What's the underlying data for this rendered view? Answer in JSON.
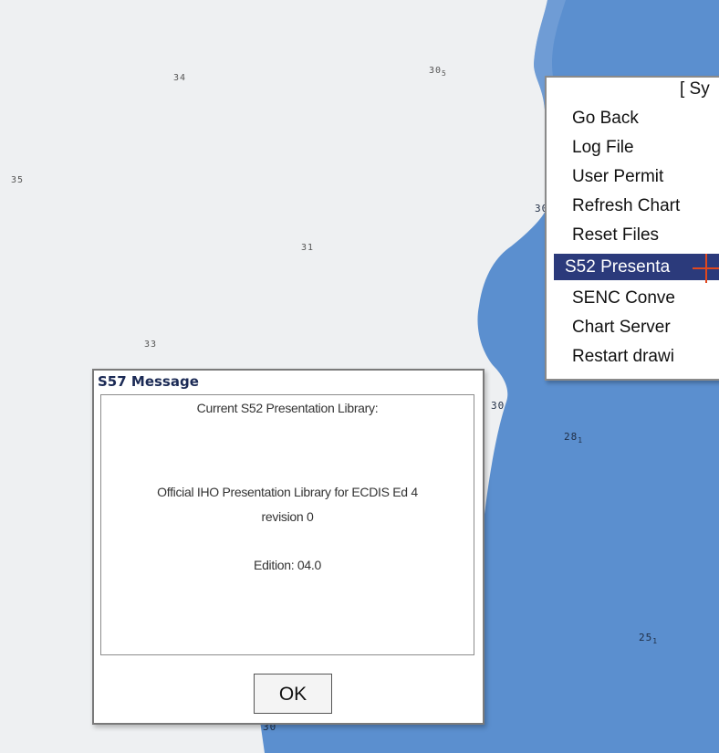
{
  "map": {
    "land_color": "#eef0f2",
    "sea_color": "#5b8fcf",
    "soundings": [
      {
        "text": "34",
        "sub": ""
      },
      {
        "text": "30",
        "sub": "5"
      },
      {
        "text": "35",
        "sub": ""
      },
      {
        "text": "31",
        "sub": ""
      },
      {
        "text": "33",
        "sub": ""
      },
      {
        "text": "30",
        "sub": ""
      },
      {
        "text": "28",
        "sub": "1"
      },
      {
        "text": "25",
        "sub": "1"
      },
      {
        "text": "30",
        "sub": ""
      },
      {
        "text": "30",
        "sub": ""
      }
    ]
  },
  "context_menu": {
    "header": "[ Sy",
    "items": [
      {
        "label": "Go Back"
      },
      {
        "label": "Log File"
      },
      {
        "label": "User Permit"
      },
      {
        "label": "Refresh Chart"
      },
      {
        "label": "Reset Files"
      },
      {
        "label": "S52 Presenta"
      },
      {
        "label": "SENC Conve"
      },
      {
        "label": "Chart Server"
      },
      {
        "label": "Restart drawi"
      }
    ],
    "selected_index": 5
  },
  "dialog": {
    "title": "S57 Message",
    "line1": "Current S52 Presentation Library:",
    "line2": "Official IHO Presentation Library for ECDIS Ed 4",
    "line3": "revision 0",
    "line4": "Edition: 04.0",
    "ok_label": "OK"
  },
  "colors": {
    "menu_selected": "#2b3a7b",
    "cursor": "#e0481e",
    "dialog_title": "#1b2a55"
  }
}
